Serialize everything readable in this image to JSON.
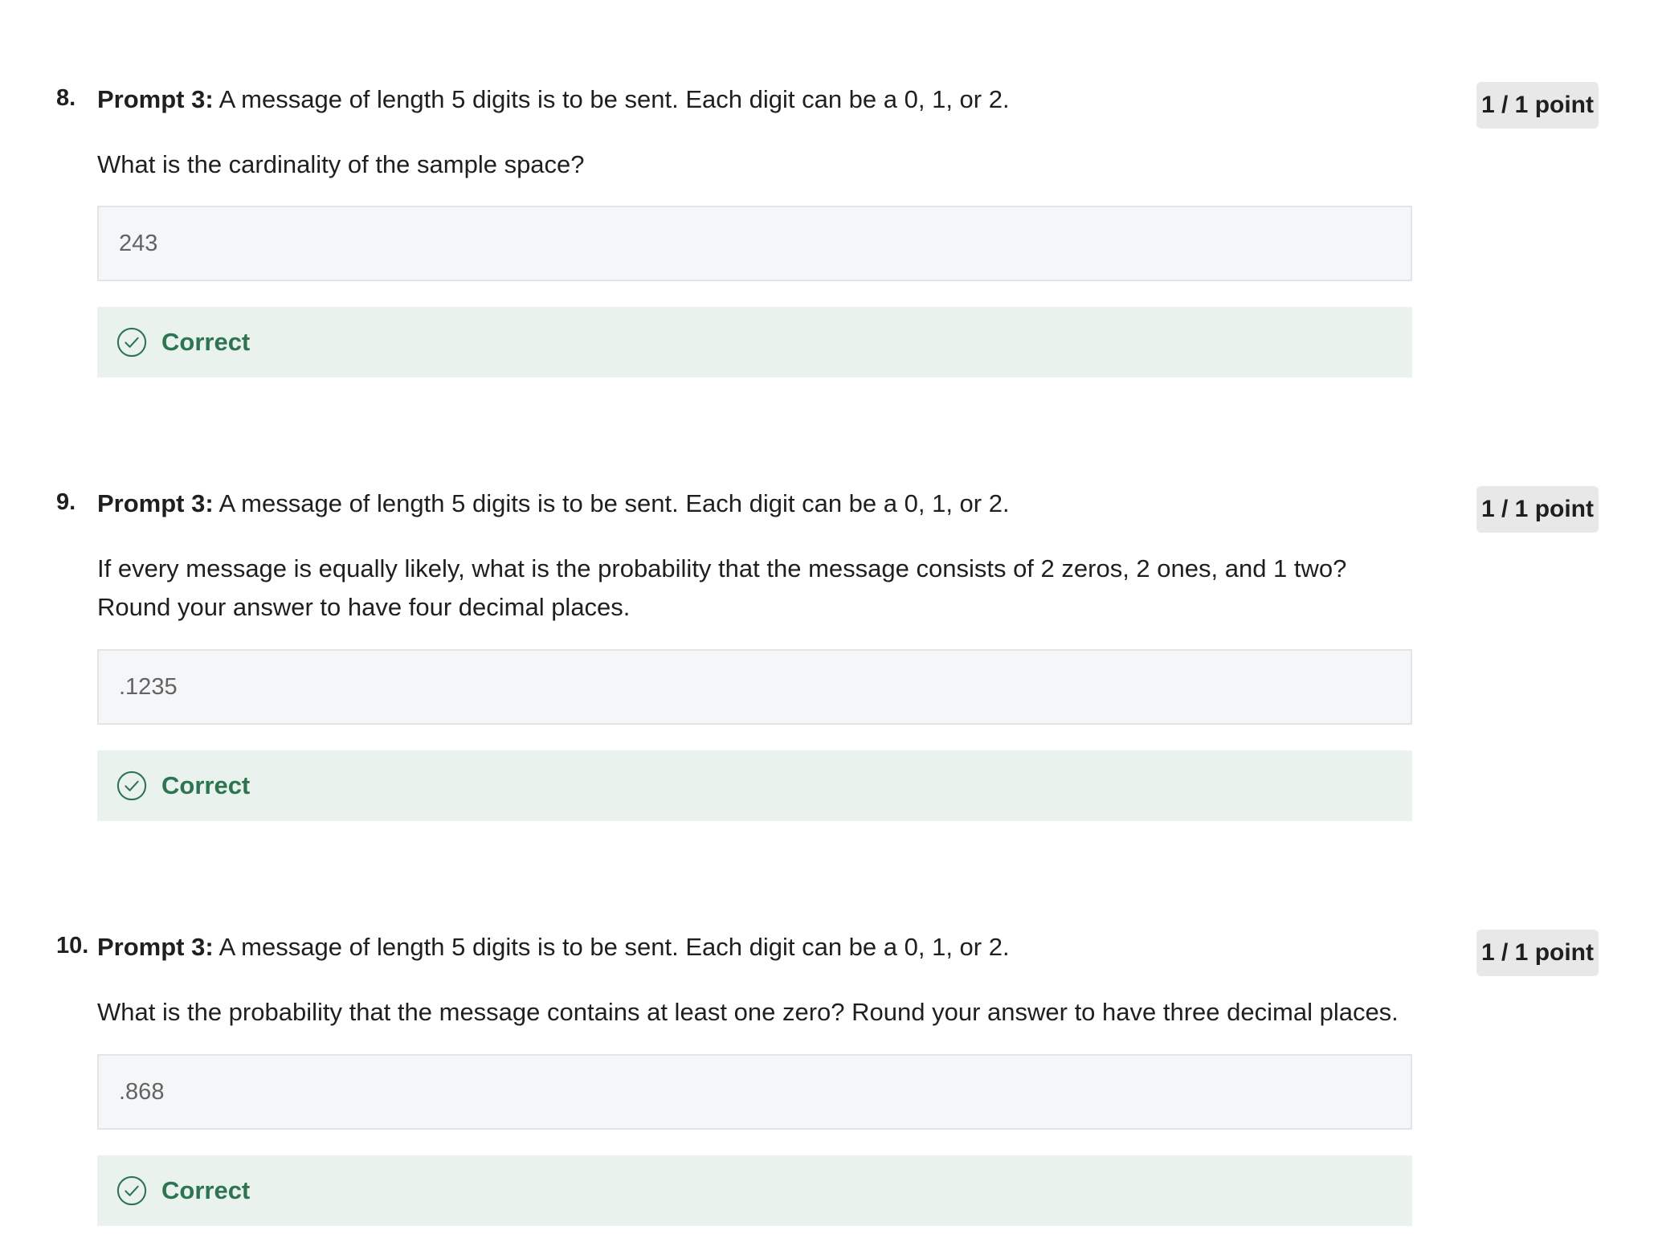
{
  "questions": [
    {
      "number": "8.",
      "prompt_label": "Prompt 3:",
      "prompt_text": " A message of length 5 digits is to be sent. Each digit can be a 0, 1, or 2.",
      "question_text": "What is the cardinality of the sample space?",
      "answer_value": "243",
      "points": "1 / 1 point",
      "feedback": "Correct",
      "feedback_icon": "check-circle-icon"
    },
    {
      "number": "9.",
      "prompt_label": "Prompt 3:",
      "prompt_text": " A message of length 5 digits is to be sent. Each digit can be a 0, 1, or 2.",
      "question_text": "If every message is equally likely, what is the probability that the message consists of 2 zeros, 2 ones, and 1 two? Round your answer to have four decimal places.",
      "answer_value": ".1235",
      "points": "1 / 1 point",
      "feedback": "Correct",
      "feedback_icon": "check-circle-icon"
    },
    {
      "number": "10.",
      "prompt_label": "Prompt 3:",
      "prompt_text": " A message of length 5 digits is to be sent. Each digit can be a 0, 1, or 2.",
      "question_text": "What is the probability that the message contains at least one zero? Round your answer to have three decimal places.",
      "answer_value": ".868",
      "points": "1 / 1 point",
      "feedback": "Correct",
      "feedback_icon": "check-circle-icon"
    }
  ],
  "colors": {
    "correct_text": "#2e7451",
    "correct_background": "#e9f2ed",
    "answer_background": "#f5f6f8",
    "badge_background": "#e8e8e8"
  }
}
